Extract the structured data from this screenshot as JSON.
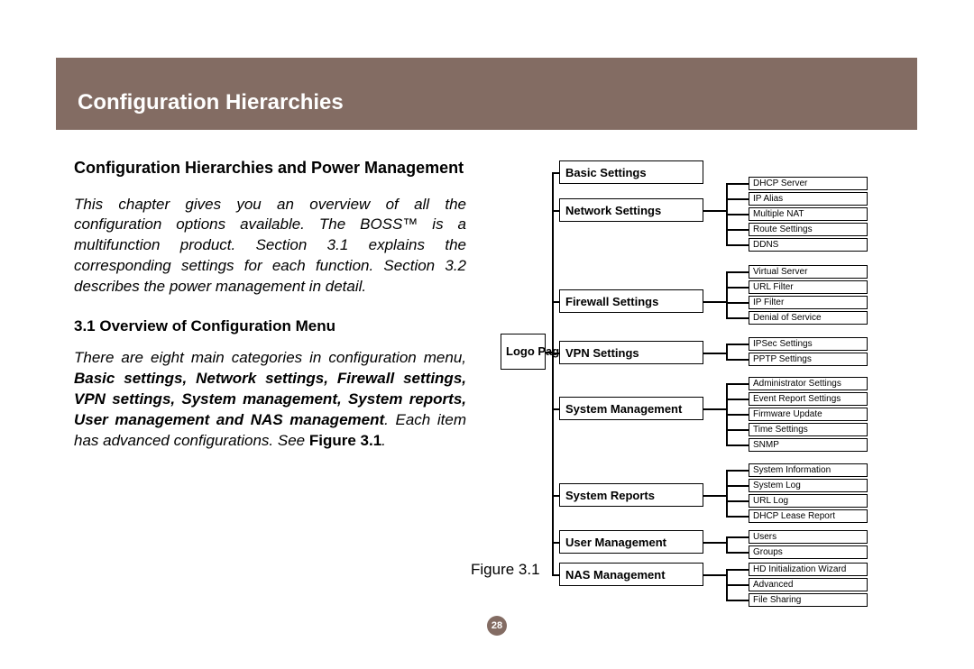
{
  "header": {
    "title": "Configuration Hierarchies"
  },
  "left": {
    "subhead": "Configuration Hierarchies and Power Management",
    "intro": "This chapter gives you an overview of all the configuration options available. The BOSS™ is a multifunction product. Section 3.1 explains the corresponding settings for each function. Section 3.2 describes the power management in detail.",
    "section_number": "3.1",
    "section_title": "Overview of Configuration Menu",
    "body_lead": "There are eight main categories in configuration menu, ",
    "body_bold": "Basic settings, Network settings, Firewall settings, VPN settings, System management, System reports, User management and NAS management",
    "body_tail": ". Each item has advanced configura­tions. See ",
    "body_figref": "Figure 3.1",
    "body_end": "."
  },
  "figure_label": "Figure 3.1",
  "page_number": "28",
  "diagram": {
    "root": "Logo Page",
    "main": [
      "Basic Settings",
      "Network Settings",
      "Firewall Settings",
      "VPN Settings",
      "System Management",
      "System Reports",
      "User Management",
      "NAS Management"
    ],
    "subs": {
      "network": [
        "DHCP Server",
        "IP Alias",
        "Multiple NAT",
        "Route Settings",
        "DDNS"
      ],
      "firewall": [
        "Virtual Server",
        "URL Filter",
        "IP Filter",
        "Denial of Service"
      ],
      "vpn": [
        "IPSec Settings",
        "PPTP Settings"
      ],
      "sysmgmt": [
        "Administrator Settings",
        "Event Report Settings",
        "Firmware Update",
        "Time Settings",
        "SNMP"
      ],
      "sysrep": [
        "System Information",
        "System Log",
        "URL Log",
        "DHCP Lease Report"
      ],
      "usermgmt": [
        "Users",
        "Groups"
      ],
      "nas": [
        "HD Initialization Wizard",
        "Advanced",
        "File Sharing"
      ]
    }
  }
}
